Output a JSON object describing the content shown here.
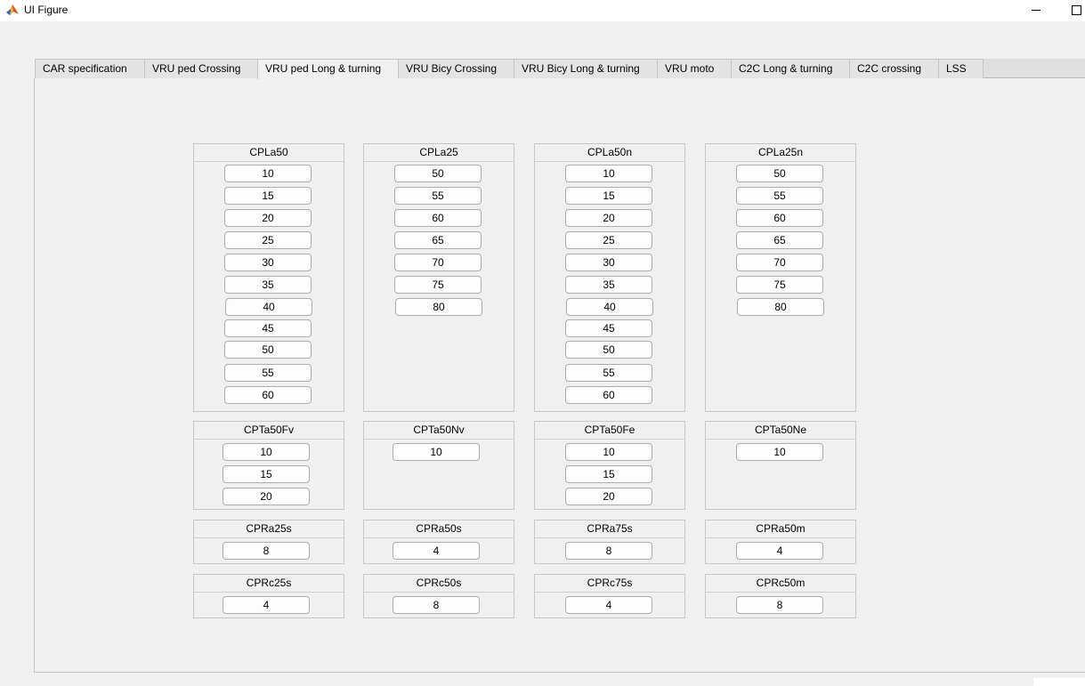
{
  "window": {
    "title": "UI Figure",
    "icon": "matlab-icon"
  },
  "tabs": [
    {
      "label": "CAR specification"
    },
    {
      "label": "VRU ped Crossing"
    },
    {
      "label": "VRU ped Long & turning",
      "active": true
    },
    {
      "label": "VRU Bicy Crossing"
    },
    {
      "label": "VRU Bicy Long & turning"
    },
    {
      "label": "VRU moto"
    },
    {
      "label": "C2C Long & turning"
    },
    {
      "label": "C2C crossing"
    },
    {
      "label": "LSS"
    }
  ],
  "panels": {
    "cpla50": {
      "title": "CPLa50",
      "buttons": [
        "10",
        "15",
        "20",
        "25",
        "30",
        "35",
        "40",
        "45",
        "50",
        "55",
        "60"
      ]
    },
    "cpla25": {
      "title": "CPLa25",
      "buttons": [
        "50",
        "55",
        "60",
        "65",
        "70",
        "75",
        "80"
      ]
    },
    "cpla50n": {
      "title": "CPLa50n",
      "buttons": [
        "10",
        "15",
        "20",
        "25",
        "30",
        "35",
        "40",
        "45",
        "50",
        "55",
        "60"
      ]
    },
    "cpla25n": {
      "title": "CPLa25n",
      "buttons": [
        "50",
        "55",
        "60",
        "65",
        "70",
        "75",
        "80"
      ]
    },
    "cpta50fv": {
      "title": "CPTa50Fv",
      "buttons": [
        "10",
        "15",
        "20"
      ]
    },
    "cpta50nv": {
      "title": "CPTa50Nv",
      "buttons": [
        "10"
      ]
    },
    "cpta50fe": {
      "title": "CPTa50Fe",
      "buttons": [
        "10",
        "15",
        "20"
      ]
    },
    "cpta50ne": {
      "title": "CPTa50Ne",
      "buttons": [
        "10"
      ]
    },
    "cpra25s": {
      "title": "CPRa25s",
      "buttons": [
        "8"
      ]
    },
    "cpra50s": {
      "title": "CPRa50s",
      "buttons": [
        "4"
      ]
    },
    "cpra75s": {
      "title": "CPRa75s",
      "buttons": [
        "8"
      ]
    },
    "cpra50m": {
      "title": "CPRa50m",
      "buttons": [
        "4"
      ]
    },
    "cprc25s": {
      "title": "CPRc25s",
      "buttons": [
        "4"
      ]
    },
    "cprc50s": {
      "title": "CPRc50s",
      "buttons": [
        "8"
      ]
    },
    "cprc75s": {
      "title": "CPRc75s",
      "buttons": [
        "4"
      ]
    },
    "cprc50m": {
      "title": "CPRc50m",
      "buttons": [
        "8"
      ]
    }
  }
}
